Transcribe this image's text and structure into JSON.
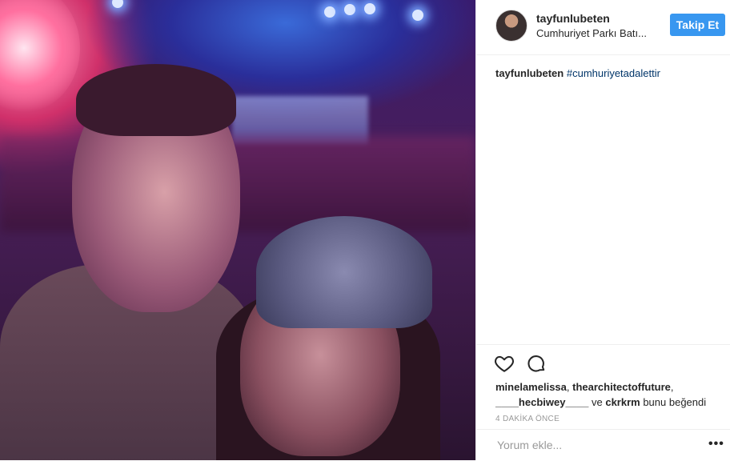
{
  "post": {
    "username": "tayfunlubeten",
    "location": "Cumhuriyet Parkı Batı...",
    "follow_label": "Takip Et",
    "caption_user": "tayfunlubeten",
    "caption_tag": "#cumhuriyetadalettir",
    "likes": {
      "user1": "minelamelissa",
      "sep1": ", ",
      "user2": "thearchitectoffuture",
      "sep2": ",",
      "user3": "____hecbiwey____",
      "and": " ve ",
      "user4": "ckrkrm",
      "suffix": " bunu beğendi"
    },
    "timestamp": "4 DAKİKA ÖNCE",
    "comment_placeholder": "Yorum ekle...",
    "more_label": "•••"
  },
  "colors": {
    "follow_button": "#3897f0",
    "hashtag": "#003569",
    "muted": "#999999"
  },
  "icons": [
    "heart-icon",
    "comment-icon",
    "more-options-icon"
  ]
}
